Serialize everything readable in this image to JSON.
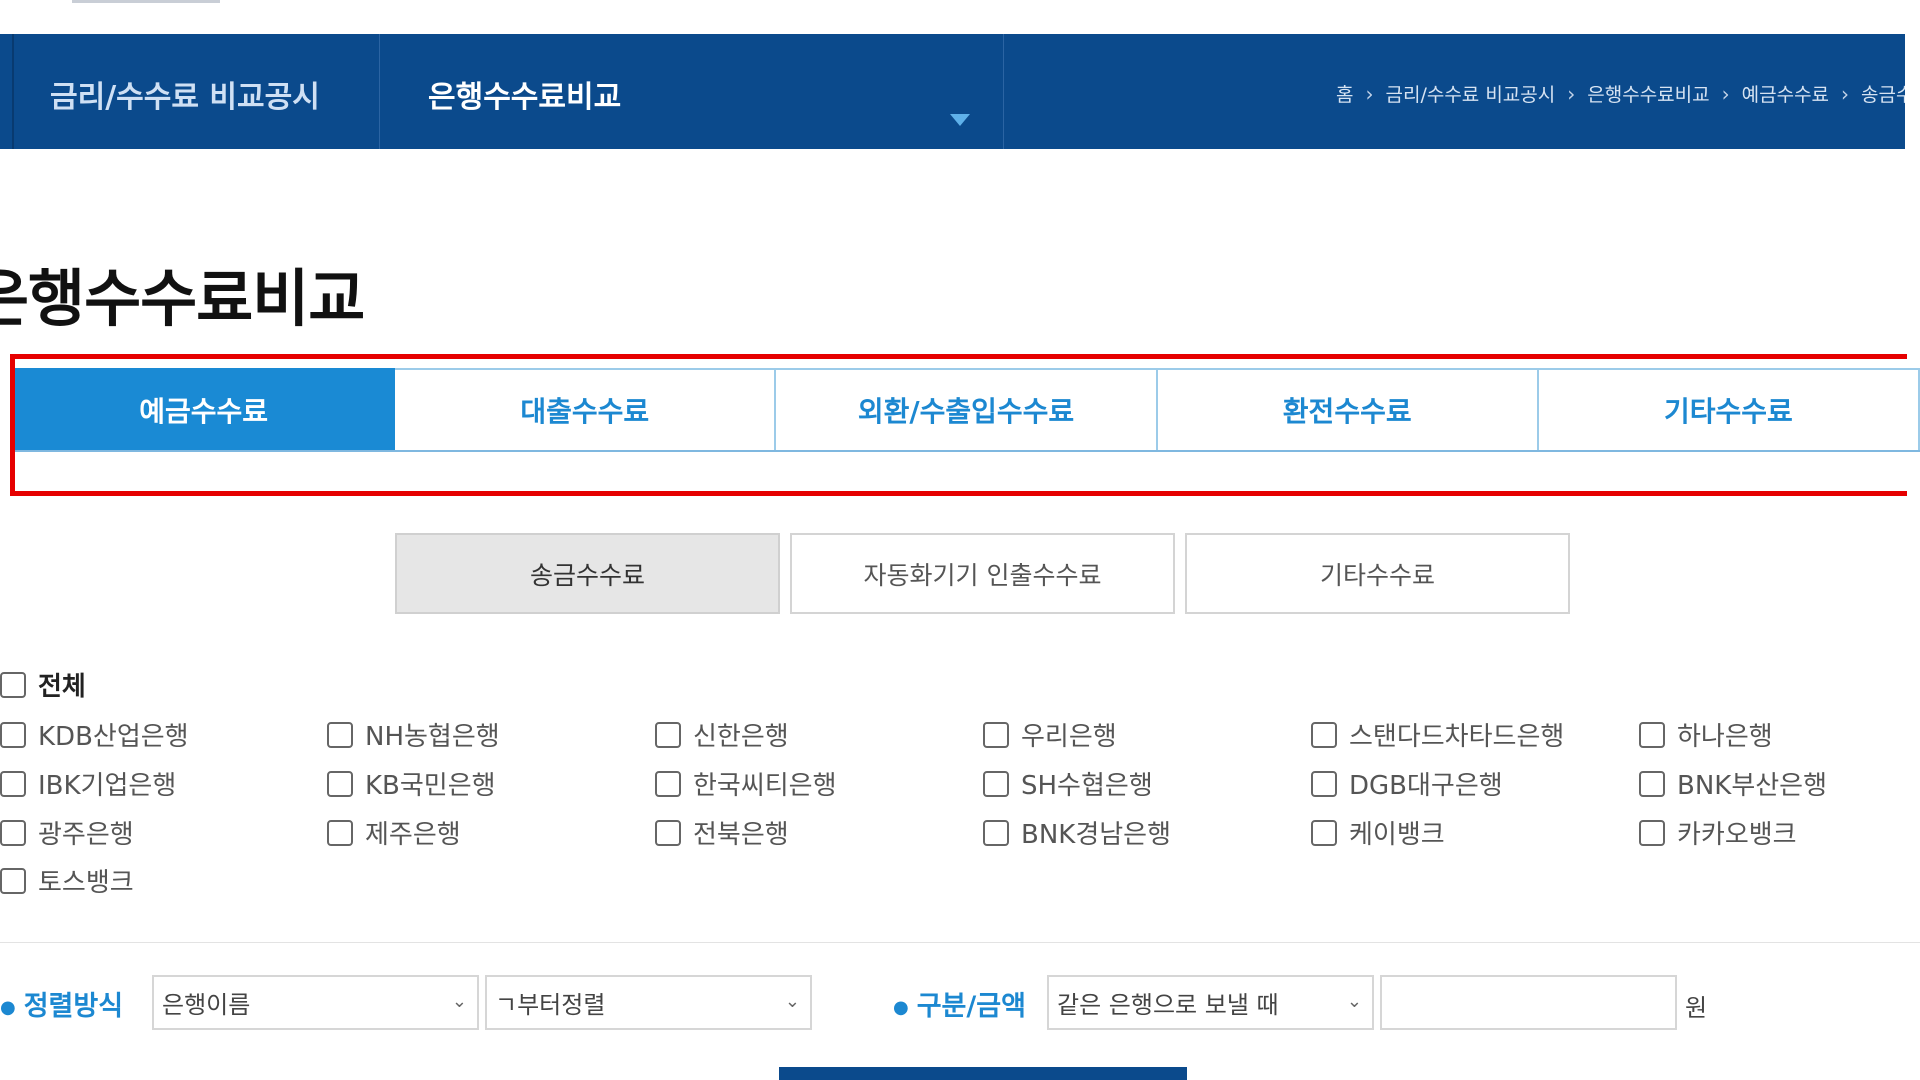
{
  "nav": {
    "section": "금리/수수료 비교공시",
    "page": "은행수수료비교",
    "breadcrumb": [
      "홈",
      "금리/수수료 비교공시",
      "은행수수료비교",
      "예금수수료",
      "송금수"
    ]
  },
  "page_title": "은행수수료비교",
  "tabs": [
    {
      "label": "예금수수료",
      "active": true
    },
    {
      "label": "대출수수료",
      "active": false
    },
    {
      "label": "외환/수출입수수료",
      "active": false
    },
    {
      "label": "환전수수료",
      "active": false
    },
    {
      "label": "기타수수료",
      "active": false
    }
  ],
  "subtabs": [
    {
      "label": "송금수수료",
      "active": true
    },
    {
      "label": "자동화기기 인출수수료",
      "active": false
    },
    {
      "label": "기타수수료",
      "active": false
    }
  ],
  "all_label": "전체",
  "banks": [
    [
      "KDB산업은행",
      "NH농협은행",
      "신한은행",
      "우리은행",
      "스탠다드차타드은행",
      "하나은행"
    ],
    [
      "IBK기업은행",
      "KB국민은행",
      "한국씨티은행",
      "SH수협은행",
      "DGB대구은행",
      "BNK부산은행"
    ],
    [
      "광주은행",
      "제주은행",
      "전북은행",
      "BNK경남은행",
      "케이뱅크",
      "카카오뱅크"
    ],
    [
      "토스뱅크"
    ]
  ],
  "filters": {
    "sort_label": "정렬방식",
    "sort_by": "은행이름",
    "sort_order": "ㄱ부터정렬",
    "type_label": "구분/금액",
    "type_value": "같은 은행으로 보낼 때",
    "amount": "",
    "unit": "원"
  },
  "colors": {
    "navy": "#0b4a8c",
    "tab_blue": "#1a8ad4",
    "highlight_red": "#e60000"
  }
}
